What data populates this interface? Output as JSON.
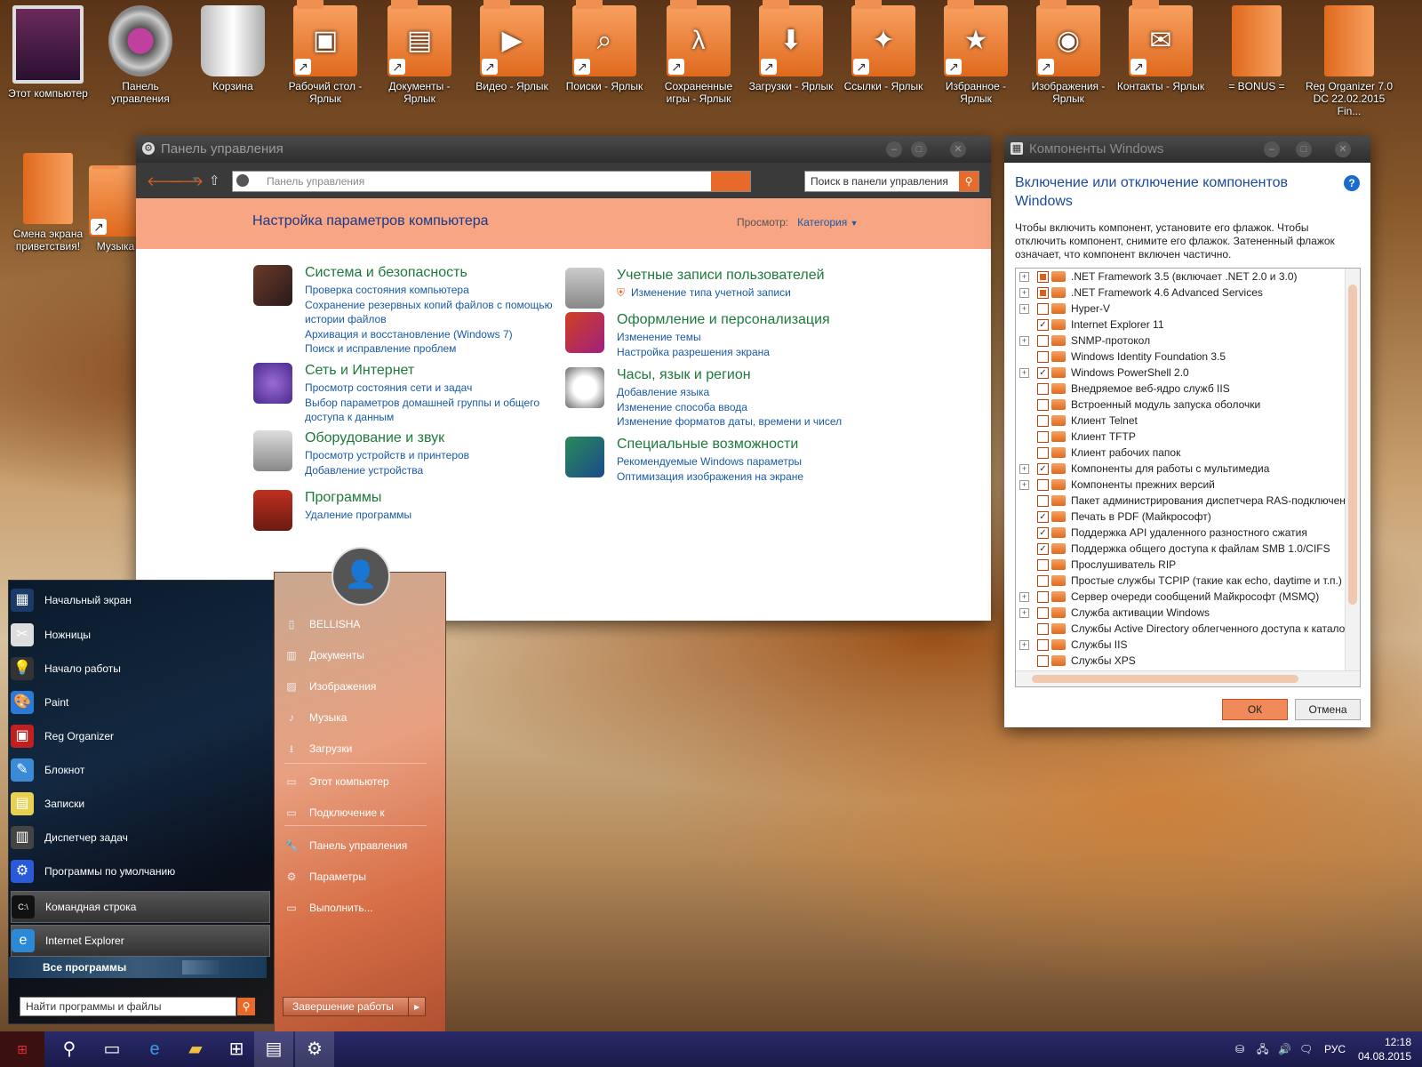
{
  "desktop_icons": [
    {
      "label": "Этот компьютер",
      "icon": "monitor-icon"
    },
    {
      "label": "Панель управления",
      "icon": "control-panel-gear-icon"
    },
    {
      "label": "Корзина",
      "icon": "recycle-bin-icon"
    },
    {
      "label": "Рабочий стол - Ярлык",
      "icon": "desktop-folder-icon"
    },
    {
      "label": "Документы - Ярлык",
      "icon": "documents-folder-icon"
    },
    {
      "label": "Видео - Ярлык",
      "icon": "video-folder-icon"
    },
    {
      "label": "Поиски - Ярлык",
      "icon": "search-folder-icon"
    },
    {
      "label": "Сохраненные игры - Ярлык",
      "icon": "saved-games-folder-icon"
    },
    {
      "label": "Загрузки - Ярлык",
      "icon": "downloads-folder-icon"
    },
    {
      "label": "Ссылки - Ярлык",
      "icon": "links-folder-icon"
    },
    {
      "label": "Избранное - Ярлык",
      "icon": "favorites-folder-icon"
    },
    {
      "label": "Изображения - Ярлык",
      "icon": "pictures-folder-icon"
    },
    {
      "label": "Контакты - Ярлык",
      "icon": "contacts-folder-icon"
    },
    {
      "label": "= BONUS =",
      "icon": "bonus-file-icon"
    },
    {
      "label": "Reg Organizer 7.0 DC 22.02.2015 Fin...",
      "icon": "reg-organizer-file-icon"
    },
    {
      "label": "Смена экрана приветствия!",
      "icon": "welcome-screen-file-icon"
    },
    {
      "label": "Музыка",
      "icon": "music-shortcut-icon"
    }
  ],
  "control_panel": {
    "title": "Панель управления",
    "address": "Панель управления",
    "search_placeholder": "Поиск в панели управления",
    "heading": "Настройка параметров компьютера",
    "view_label": "Просмотр:",
    "view_value": "Категория",
    "categories": [
      {
        "title": "Система и безопасность",
        "links": [
          "Проверка состояния компьютера",
          "Сохранение резервных копий файлов с помощью",
          "истории файлов",
          "Архивация и восстановление (Windows 7)",
          "Поиск и исправление проблем"
        ]
      },
      {
        "title": "Сеть и Интернет",
        "links": [
          "Просмотр состояния сети и задач",
          "Выбор параметров домашней группы и общего",
          "доступа к данным"
        ]
      },
      {
        "title": "Оборудование и звук",
        "links": [
          "Просмотр устройств и принтеров",
          "Добавление устройства"
        ]
      },
      {
        "title": "Программы",
        "links": [
          "Удаление программы"
        ]
      },
      {
        "title": "Учетные записи пользователей",
        "links": [
          "Изменение типа учетной записи"
        ]
      },
      {
        "title": "Оформление и персонализация",
        "links": [
          "Изменение темы",
          "Настройка разрешения экрана"
        ]
      },
      {
        "title": "Часы, язык и регион",
        "links": [
          "Добавление языка",
          "Изменение способа ввода",
          "Изменение форматов даты, времени и чисел"
        ]
      },
      {
        "title": "Специальные возможности",
        "links": [
          "Рекомендуемые Windows параметры",
          "Оптимизация изображения на экране"
        ]
      }
    ]
  },
  "components": {
    "title": "Компоненты Windows",
    "heading": "Включение или отключение компонентов Windows",
    "description": "Чтобы включить компонент, установите его флажок. Чтобы отключить компонент, снимите его флажок. Затененный флажок означает, что компонент включен частично.",
    "items": [
      {
        "name": ".NET Framework 3.5 (включает .NET 2.0 и 3.0)",
        "state": "partial",
        "expandable": true
      },
      {
        "name": ".NET Framework 4.6 Advanced Services",
        "state": "partial",
        "expandable": true
      },
      {
        "name": "Hyper-V",
        "state": "unchecked",
        "expandable": true
      },
      {
        "name": "Internet Explorer 11",
        "state": "checked",
        "expandable": false
      },
      {
        "name": "SNMP-протокол",
        "state": "unchecked",
        "expandable": true
      },
      {
        "name": "Windows Identity Foundation 3.5",
        "state": "unchecked",
        "expandable": false
      },
      {
        "name": "Windows PowerShell 2.0",
        "state": "checked",
        "expandable": true
      },
      {
        "name": "Внедряемое веб-ядро служб IIS",
        "state": "unchecked",
        "expandable": false
      },
      {
        "name": "Встроенный модуль запуска оболочки",
        "state": "unchecked",
        "expandable": false
      },
      {
        "name": "Клиент Telnet",
        "state": "unchecked",
        "expandable": false
      },
      {
        "name": "Клиент TFTP",
        "state": "unchecked",
        "expandable": false
      },
      {
        "name": "Клиент рабочих папок",
        "state": "unchecked",
        "expandable": false
      },
      {
        "name": "Компоненты для работы с мультимедиа",
        "state": "checked",
        "expandable": true
      },
      {
        "name": "Компоненты прежних версий",
        "state": "unchecked",
        "expandable": true
      },
      {
        "name": "Пакет администрирования диспетчера RAS-подключений",
        "state": "unchecked",
        "expandable": false
      },
      {
        "name": "Печать в PDF (Майкрософт)",
        "state": "checked",
        "expandable": false
      },
      {
        "name": "Поддержка API удаленного разностного сжатия",
        "state": "checked",
        "expandable": false
      },
      {
        "name": "Поддержка общего доступа к файлам SMB 1.0/CIFS",
        "state": "checked",
        "expandable": false
      },
      {
        "name": "Прослушиватель RIP",
        "state": "unchecked",
        "expandable": false
      },
      {
        "name": "Простые службы TCPIP (такие как echo, daytime и т.п.)",
        "state": "unchecked",
        "expandable": false
      },
      {
        "name": "Сервер очереди сообщений Майкрософт (MSMQ)",
        "state": "unchecked",
        "expandable": true
      },
      {
        "name": "Служба активации Windows",
        "state": "unchecked",
        "expandable": true
      },
      {
        "name": "Службы Active Directory облегченного доступа к каталогам",
        "state": "unchecked",
        "expandable": false
      },
      {
        "name": "Службы IIS",
        "state": "unchecked",
        "expandable": true
      },
      {
        "name": "Службы XPS",
        "state": "unchecked",
        "expandable": false
      }
    ],
    "ok_label": "ОК",
    "cancel_label": "Отмена"
  },
  "start_menu": {
    "left_items": [
      {
        "label": "Начальный экран",
        "icon": "start-screen-icon"
      },
      {
        "label": "Ножницы",
        "icon": "scissors-icon"
      },
      {
        "label": "Начало работы",
        "icon": "lightbulb-icon"
      },
      {
        "label": "Paint",
        "icon": "paint-icon"
      },
      {
        "label": "Reg Organizer",
        "icon": "reg-organizer-icon"
      },
      {
        "label": "Блокнот",
        "icon": "notepad-icon"
      },
      {
        "label": "Записки",
        "icon": "sticky-notes-icon"
      },
      {
        "label": "Диспетчер задач",
        "icon": "task-manager-icon"
      },
      {
        "label": "Программы по умолчанию",
        "icon": "default-programs-gear-icon"
      },
      {
        "label": "Командная строка",
        "icon": "command-prompt-icon"
      },
      {
        "label": "Internet Explorer",
        "icon": "internet-explorer-icon"
      }
    ],
    "all_programs": "Все программы",
    "search_placeholder": "Найти программы и файлы",
    "right_items": [
      {
        "label": "BELLISHA",
        "icon": "user-folder-icon"
      },
      {
        "label": "Документы",
        "icon": "documents-icon"
      },
      {
        "label": "Изображения",
        "icon": "pictures-icon"
      },
      {
        "label": "Музыка",
        "icon": "music-icon"
      },
      {
        "label": "Загрузки",
        "icon": "downloads-icon"
      },
      {
        "label": "Этот компьютер",
        "icon": "computer-icon"
      },
      {
        "label": "Подключение к",
        "icon": "connect-icon"
      },
      {
        "label": "Панель управления",
        "icon": "control-panel-icon"
      },
      {
        "label": "Параметры",
        "icon": "settings-icon"
      },
      {
        "label": "Выполнить...",
        "icon": "run-icon"
      }
    ],
    "shutdown_label": "Завершение работы"
  },
  "taskbar": {
    "language": "РУС",
    "time": "12:18",
    "date": "04.08.2015"
  }
}
